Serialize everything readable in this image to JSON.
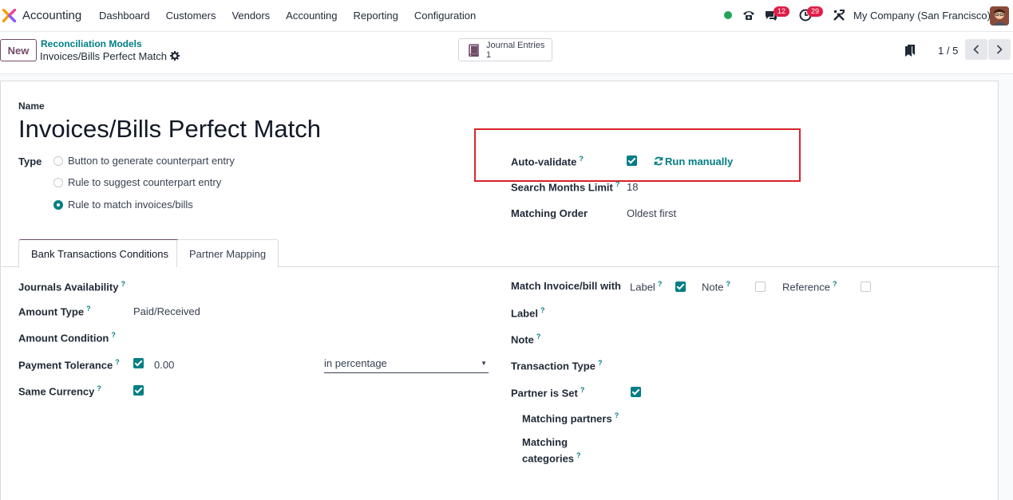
{
  "app": {
    "name": "Accounting"
  },
  "menu": [
    "Dashboard",
    "Customers",
    "Vendors",
    "Accounting",
    "Reporting",
    "Configuration"
  ],
  "systray": {
    "messages_count": "12",
    "activities_count": "29",
    "company": "My Company (San Francisco)"
  },
  "control": {
    "new_label": "New",
    "breadcrumb_parent": "Reconciliation Models",
    "breadcrumb_current": "Invoices/Bills Perfect Match",
    "smart_button": {
      "label": "Journal Entries",
      "value": "1"
    },
    "pager": "1 / 5"
  },
  "form": {
    "name_label": "Name",
    "name_value": "Invoices/Bills Perfect Match",
    "type_label": "Type",
    "type_options": [
      {
        "label": "Button to generate counterpart entry",
        "selected": false
      },
      {
        "label": "Rule to suggest counterpart entry",
        "selected": false
      },
      {
        "label": "Rule to match invoices/bills",
        "selected": true
      }
    ],
    "auto_validate_label": "Auto-validate",
    "auto_validate": true,
    "run_manually_label": "Run manually",
    "search_months_label": "Search Months Limit",
    "search_months_value": "18",
    "matching_order_label": "Matching Order",
    "matching_order_value": "Oldest first"
  },
  "tabs": [
    {
      "label": "Bank Transactions Conditions",
      "active": true
    },
    {
      "label": "Partner Mapping",
      "active": false
    }
  ],
  "conditions": {
    "journals_label": "Journals Availability",
    "amount_type_label": "Amount Type",
    "amount_type_value": "Paid/Received",
    "amount_condition_label": "Amount Condition",
    "payment_tolerance_label": "Payment Tolerance",
    "payment_tolerance_checked": true,
    "payment_tolerance_value": "0.00",
    "tolerance_type_value": "in percentage",
    "same_currency_label": "Same Currency",
    "same_currency_checked": true,
    "match_with_label": "Match Invoice/bill with",
    "match_label_option": "Label",
    "match_label_checked": true,
    "match_note_option": "Note",
    "match_note_checked": false,
    "match_reference_option": "Reference",
    "match_reference_checked": false,
    "label_label": "Label",
    "note_label": "Note",
    "transaction_type_label": "Transaction Type",
    "partner_set_label": "Partner is Set",
    "partner_set_checked": true,
    "matching_partners_label": "Matching partners",
    "matching_categories_line1": "Matching",
    "matching_categories_line2": "categories"
  },
  "tooltip_mark": "?",
  "colors": {
    "brand": "#714b67",
    "teal": "#017e84",
    "highlight": "#d8232a",
    "badge": "#e11d48"
  }
}
